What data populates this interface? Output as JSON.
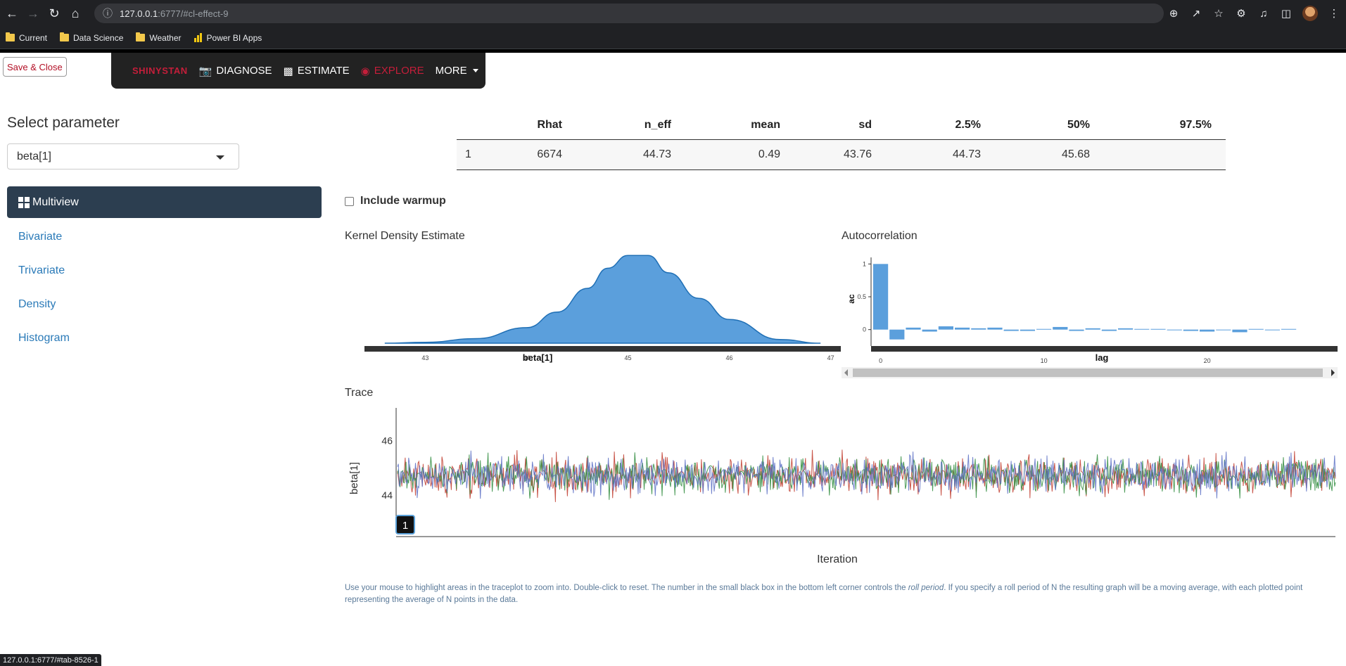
{
  "browser": {
    "url_host": "127.0.0.1",
    "url_rest": ":6777/#cl-effect-9",
    "bookmarks": [
      {
        "label": "Current",
        "icon": "folder-icon"
      },
      {
        "label": "Data Science",
        "icon": "folder-icon"
      },
      {
        "label": "Weather",
        "icon": "folder-icon"
      },
      {
        "label": "Power BI Apps",
        "icon": "powerbi-icon"
      }
    ],
    "status_url": "127.0.0.1:6777/#tab-8526-1"
  },
  "app": {
    "save_close_label": "Save & Close",
    "nav": {
      "brand": "SHINYSTAN",
      "diagnose": "DIAGNOSE",
      "estimate": "ESTIMATE",
      "explore": "EXPLORE",
      "more": "MORE"
    },
    "sidebar": {
      "title": "Select parameter",
      "selected_param": "beta[1]",
      "menu": [
        "Multiview",
        "Bivariate",
        "Trivariate",
        "Density",
        "Histogram"
      ],
      "active_index": 0
    },
    "summary": {
      "headers": [
        "",
        "Rhat",
        "n_eff",
        "mean",
        "sd",
        "2.5%",
        "50%",
        "97.5%"
      ],
      "row": [
        "1",
        "6674",
        "44.73",
        "0.49",
        "43.76",
        "44.73",
        "45.68",
        ""
      ]
    },
    "include_warmup_label": "Include warmup",
    "include_warmup_checked": false,
    "kde": {
      "title": "Kernel Density Estimate",
      "xlabel": "beta[1]",
      "ticks": [
        "43",
        "44",
        "45",
        "46",
        "47"
      ]
    },
    "autocorr": {
      "title": "Autocorrelation",
      "xlabel": "lag",
      "ylabel": "ac",
      "yticks": [
        "0",
        "0.5",
        "1"
      ],
      "xticks": [
        "0",
        "10",
        "20"
      ]
    },
    "trace": {
      "title": "Trace",
      "ylabel": "beta[1]",
      "xlabel": "Iteration",
      "yticks": [
        "44",
        "46"
      ],
      "roll_period": "1",
      "series_colors": [
        "#c0392b",
        "#2e8b3c",
        "#5a6fc4"
      ]
    },
    "help": {
      "pre": "Use your mouse to highlight areas in the traceplot to zoom into. Double-click to reset. The number in the small black box in the bottom left corner controls the ",
      "em": "roll period",
      "post": ". If you specify a roll period of N the resulting graph will be a moving average, with each plotted point representing the average of N points in the data."
    }
  },
  "chart_data": [
    {
      "type": "area",
      "title": "Kernel Density Estimate",
      "xlabel": "beta[1]",
      "x": [
        42.6,
        43.0,
        43.5,
        44.0,
        44.3,
        44.6,
        44.8,
        45.0,
        45.2,
        45.4,
        45.7,
        46.0,
        46.5,
        46.9
      ],
      "y": [
        0.0,
        0.01,
        0.05,
        0.17,
        0.34,
        0.6,
        0.82,
        0.96,
        0.96,
        0.77,
        0.49,
        0.26,
        0.04,
        0.0
      ],
      "xlim": [
        42.4,
        47.1
      ]
    },
    {
      "type": "bar",
      "title": "Autocorrelation",
      "xlabel": "lag",
      "ylabel": "ac",
      "categories": [
        0,
        1,
        2,
        3,
        4,
        5,
        6,
        7,
        8,
        9,
        10,
        11,
        12,
        13,
        14,
        15,
        16,
        17,
        18,
        19,
        20,
        21,
        22,
        23,
        24,
        25
      ],
      "values": [
        1.0,
        -0.15,
        0.03,
        -0.03,
        0.05,
        0.03,
        0.02,
        0.03,
        -0.02,
        -0.02,
        0.01,
        0.04,
        -0.02,
        0.02,
        -0.02,
        0.02,
        0.01,
        0.01,
        -0.01,
        -0.02,
        -0.03,
        0.0,
        -0.04,
        0.01,
        0.0,
        0.01
      ],
      "ylim": [
        -0.25,
        1.1
      ]
    },
    {
      "type": "line",
      "title": "Trace",
      "xlabel": "Iteration",
      "ylabel": "beta[1]",
      "ylim": [
        42.6,
        47.2
      ],
      "series_approx": [
        {
          "color": "#c0392b",
          "mean": 44.73,
          "sd": 0.49
        },
        {
          "color": "#2e8b3c",
          "mean": 44.73,
          "sd": 0.49
        },
        {
          "color": "#5a6fc4",
          "mean": 44.73,
          "sd": 0.49
        }
      ]
    }
  ]
}
